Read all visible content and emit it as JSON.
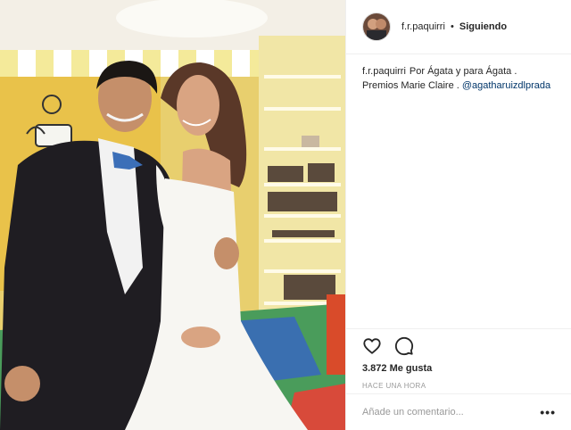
{
  "post": {
    "author": {
      "username": "f.r.paquirri",
      "separator": "•",
      "follow_status": "Siguiendo"
    },
    "caption": {
      "username": "f.r.paquirri",
      "text": "Por Ágata y para Ágata . Premios Marie Claire . ",
      "mention": "@agatharuizdlprada"
    },
    "actions": {
      "like_icon": "heart-icon",
      "comment_icon": "comment-icon",
      "likes": "3.872 Me gusta",
      "timestamp": "HACE UNA HORA"
    },
    "comment": {
      "placeholder": "Añade un comentario...",
      "more_icon": "more-options-icon",
      "more_label": "•••"
    }
  },
  "colors": {
    "wall_yellow": "#e9d27a",
    "link_blue": "#003569",
    "muted_gray": "#999999"
  }
}
